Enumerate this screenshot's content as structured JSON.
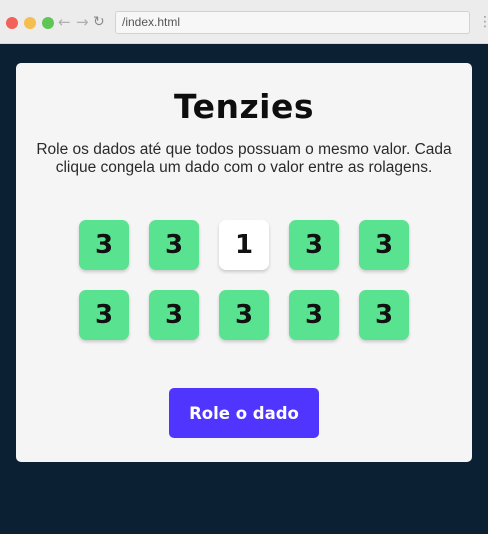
{
  "browser": {
    "url": "/index.html",
    "back_icon": "arrow-left-icon",
    "forward_icon": "arrow-right-icon",
    "reload_icon": "reload-icon",
    "menu_icon": "vertical-dots-icon"
  },
  "game": {
    "title": "Tenzies",
    "instructions": "Role os dados até que todos possuam o mesmo valor. Cada clique congela um dado com o valor entre as rolagens.",
    "dice": [
      {
        "value": "3",
        "held": true
      },
      {
        "value": "3",
        "held": true
      },
      {
        "value": "1",
        "held": false
      },
      {
        "value": "3",
        "held": true
      },
      {
        "value": "3",
        "held": true
      },
      {
        "value": "3",
        "held": true
      },
      {
        "value": "3",
        "held": true
      },
      {
        "value": "3",
        "held": true
      },
      {
        "value": "3",
        "held": true
      },
      {
        "value": "3",
        "held": true
      }
    ],
    "roll_button_label": "Role o dado"
  },
  "colors": {
    "page_background": "#0b2033",
    "card_background": "#f5f5f5",
    "held_die": "#59e391",
    "free_die": "#ffffff",
    "button": "#5035ff"
  }
}
